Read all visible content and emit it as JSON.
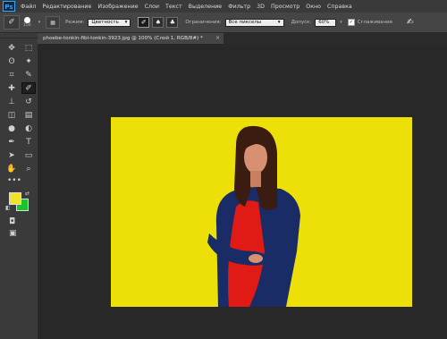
{
  "app": {
    "logo": "Ps"
  },
  "menu": {
    "items": [
      "Файл",
      "Редактирование",
      "Изображение",
      "Слои",
      "Текст",
      "Выделение",
      "Фильтр",
      "3D",
      "Просмотр",
      "Окно",
      "Справка"
    ]
  },
  "options": {
    "brush_size": "150",
    "mode_label": "Режим:",
    "mode_value": "Цветность",
    "limits_label": "Ограничения:",
    "limits_value": "Все пикселы",
    "tolerance_label": "Допуск:",
    "tolerance_value": "60%",
    "antialias_label": "Сглаживание",
    "antialias_checked": true
  },
  "document": {
    "tab_title": "phoebe-tonkin-fibi-tonkin-3923.jpg @ 100% (Слой 1, RGB/8#) *",
    "close_glyph": "×"
  },
  "tools": [
    {
      "name": "move-tool-icon",
      "glyph": "✥"
    },
    {
      "name": "marquee-tool-icon",
      "glyph": "⬚"
    },
    {
      "name": "lasso-tool-icon",
      "glyph": "ʘ"
    },
    {
      "name": "magic-wand-icon",
      "glyph": "✦"
    },
    {
      "name": "crop-tool-icon",
      "glyph": "⌗"
    },
    {
      "name": "eyedropper-icon",
      "glyph": "✎"
    },
    {
      "name": "healing-brush-icon",
      "glyph": "✚"
    },
    {
      "name": "color-replacement-icon",
      "glyph": "✐"
    },
    {
      "name": "clone-stamp-icon",
      "glyph": "⊥"
    },
    {
      "name": "history-brush-icon",
      "glyph": "↺"
    },
    {
      "name": "eraser-icon",
      "glyph": "◫"
    },
    {
      "name": "gradient-icon",
      "glyph": "▤"
    },
    {
      "name": "blur-icon",
      "glyph": "●"
    },
    {
      "name": "dodge-icon",
      "glyph": "◐"
    },
    {
      "name": "pen-tool-icon",
      "glyph": "✒"
    },
    {
      "name": "type-tool-icon",
      "glyph": "T"
    },
    {
      "name": "path-selection-icon",
      "glyph": "➤"
    },
    {
      "name": "shape-tool-icon",
      "glyph": "▭"
    },
    {
      "name": "hand-tool-icon",
      "glyph": "✋"
    },
    {
      "name": "zoom-tool-icon",
      "glyph": "⌕"
    }
  ],
  "colors": {
    "foreground": "#f1e12b",
    "background": "#18c52b",
    "photo_bg": "#ece008"
  }
}
